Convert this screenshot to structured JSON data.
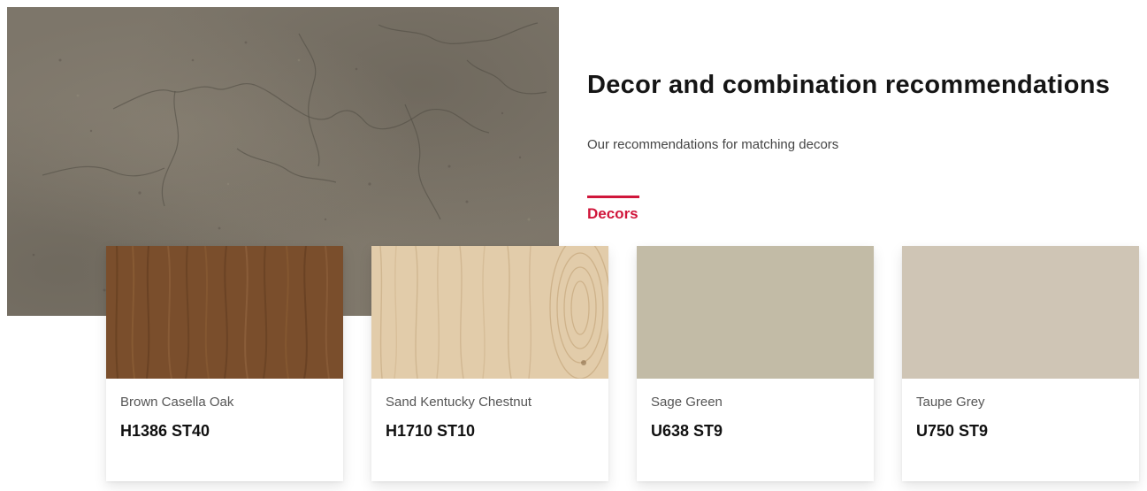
{
  "hero": {
    "image": "concrete-texture-image",
    "color": "#7d766a"
  },
  "section": {
    "title": "Decor and combination recommendations",
    "subtitle": "Our recommendations for matching decors",
    "tab_label": "Decors",
    "accent_color": "#d0163b"
  },
  "cards": [
    {
      "name": "Brown Casella Oak",
      "code": "H1386 ST40",
      "swatch_color": "#7a4e2c"
    },
    {
      "name": "Sand Kentucky Chestnut",
      "code": "H1710 ST10",
      "swatch_color": "#e2ccaa"
    },
    {
      "name": "Sage Green",
      "code": "U638 ST9",
      "swatch_color": "#c2bba6"
    },
    {
      "name": "Taupe Grey",
      "code": "U750 ST9",
      "swatch_color": "#cfc5b5"
    }
  ]
}
